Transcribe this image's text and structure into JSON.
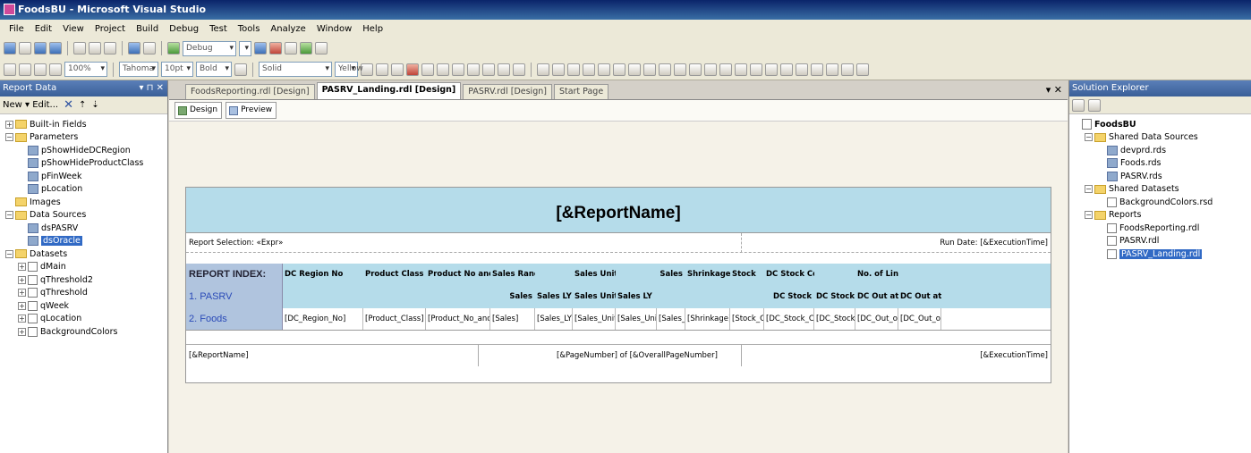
{
  "window": {
    "title": "FoodsBU - Microsoft Visual Studio"
  },
  "menu": [
    "File",
    "Edit",
    "View",
    "Project",
    "Build",
    "Debug",
    "Test",
    "Tools",
    "Analyze",
    "Window",
    "Help"
  ],
  "toolbar": {
    "config": "Debug",
    "zoom": "100%",
    "font": "Tahoma",
    "size": "10pt",
    "weight": "Bold",
    "fill": "Solid",
    "fill2": "Yellow"
  },
  "left_panel": {
    "title": "Report Data",
    "pin": "▾ ⊓ ✕",
    "new_label": "New ▾ Edit...",
    "items": [
      {
        "label": "Built-in Fields",
        "level": 0,
        "pm": "+",
        "icon": "folder"
      },
      {
        "label": "Parameters",
        "level": 0,
        "pm": "-",
        "icon": "folder"
      },
      {
        "label": "pShowHideDCRegion",
        "level": 1,
        "pm": "",
        "icon": "param"
      },
      {
        "label": "pShowHideProductClass",
        "level": 1,
        "pm": "",
        "icon": "param"
      },
      {
        "label": "pFinWeek",
        "level": 1,
        "pm": "",
        "icon": "param"
      },
      {
        "label": "pLocation",
        "level": 1,
        "pm": "",
        "icon": "param"
      },
      {
        "label": "Images",
        "level": 0,
        "pm": "",
        "icon": "folder"
      },
      {
        "label": "Data Sources",
        "level": 0,
        "pm": "-",
        "icon": "folder"
      },
      {
        "label": "dsPASRV",
        "level": 1,
        "pm": "",
        "icon": "param"
      },
      {
        "label": "dsOracle",
        "level": 1,
        "pm": "",
        "icon": "param",
        "selected": true
      },
      {
        "label": "Datasets",
        "level": 0,
        "pm": "-",
        "icon": "folder"
      },
      {
        "label": "dMain",
        "level": 1,
        "pm": "+",
        "icon": "doc"
      },
      {
        "label": "qThreshold2",
        "level": 1,
        "pm": "+",
        "icon": "doc"
      },
      {
        "label": "qThreshold",
        "level": 1,
        "pm": "+",
        "icon": "doc"
      },
      {
        "label": "qWeek",
        "level": 1,
        "pm": "+",
        "icon": "doc"
      },
      {
        "label": "qLocation",
        "level": 1,
        "pm": "+",
        "icon": "doc"
      },
      {
        "label": "BackgroundColors",
        "level": 1,
        "pm": "+",
        "icon": "doc"
      }
    ]
  },
  "tabs": [
    {
      "label": "FoodsReporting.rdl [Design]",
      "active": false
    },
    {
      "label": "PASRV_Landing.rdl [Design]",
      "active": true
    },
    {
      "label": "PASRV.rdl [Design]",
      "active": false
    },
    {
      "label": "Start Page",
      "active": false
    }
  ],
  "tab_close": "▾ ✕",
  "design_tabs": {
    "design": "Design",
    "preview": "Preview"
  },
  "report": {
    "title": "[&ReportName]",
    "selection": "Report Selection: «Expr»",
    "rundate": "Run Date: [&ExecutionTime]",
    "index_header": "REPORT INDEX:",
    "index_items": [
      "1. PASRV",
      "2. Foods"
    ],
    "header1": [
      "DC Region No",
      "Product Class",
      "Product No and",
      "Sales Rands",
      "",
      "Sales Units",
      "",
      "Sales",
      "Shrinkage",
      "Stock",
      "DC Stock Cover",
      "",
      "No. of Lines Out of",
      ""
    ],
    "header2": [
      "",
      "",
      "",
      "Sales",
      "Sales LY",
      "Sales Units",
      "Sales LY",
      "",
      "",
      "",
      "DC Stock",
      "DC Stock",
      "DC Out at",
      "DC Out at"
    ],
    "data_row": [
      "[DC_Region_No]",
      "[Product_Class]",
      "[Product_No_and_",
      "[Sales]",
      "[Sales_LY_Pe",
      "[Sales_Units]",
      "[Sales_Units_",
      "[Sales_Margi",
      "[Shrinkage]",
      "[Stock_Cove",
      "[DC_Stock_C",
      "[DC_Stock_C",
      "[DC_Out_of_",
      "[DC_Out_of_"
    ],
    "footer_left": "[&ReportName]",
    "footer_mid": "[&PageNumber] of [&OverallPageNumber]",
    "footer_right": "[&ExecutionTime]"
  },
  "right_panel": {
    "title": "Solution Explorer",
    "items": [
      {
        "label": "FoodsBU",
        "level": 0,
        "pm": "",
        "icon": "sol"
      },
      {
        "label": "Shared Data Sources",
        "level": 1,
        "pm": "-",
        "icon": "folder"
      },
      {
        "label": "devprd.rds",
        "level": 2,
        "pm": "",
        "icon": "param"
      },
      {
        "label": "Foods.rds",
        "level": 2,
        "pm": "",
        "icon": "param"
      },
      {
        "label": "PASRV.rds",
        "level": 2,
        "pm": "",
        "icon": "param"
      },
      {
        "label": "Shared Datasets",
        "level": 1,
        "pm": "-",
        "icon": "folder"
      },
      {
        "label": "BackgroundColors.rsd",
        "level": 2,
        "pm": "",
        "icon": "doc"
      },
      {
        "label": "Reports",
        "level": 1,
        "pm": "-",
        "icon": "folder"
      },
      {
        "label": "FoodsReporting.rdl",
        "level": 2,
        "pm": "",
        "icon": "doc"
      },
      {
        "label": "PASRV.rdl",
        "level": 2,
        "pm": "",
        "icon": "doc"
      },
      {
        "label": "PASRV_Landing.rdl",
        "level": 2,
        "pm": "",
        "icon": "doc",
        "selected": true
      }
    ]
  }
}
